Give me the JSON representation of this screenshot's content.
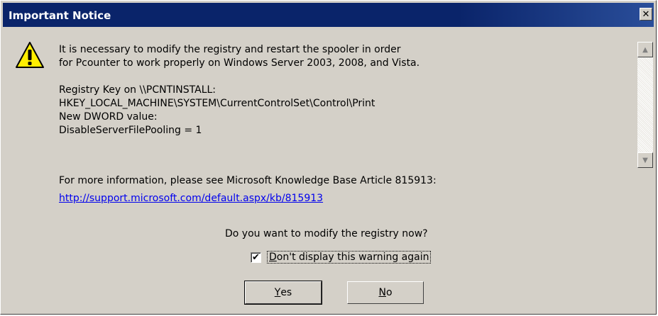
{
  "window": {
    "title": "Important Notice",
    "close_glyph": "✕",
    "icon": "warning-icon"
  },
  "message": {
    "lines": [
      "It is necessary to modify the registry and restart the spooler in order",
      "for Pcounter to work properly on Windows Server 2003, 2008, and Vista.",
      "",
      "Registry Key on \\\\PCNTINSTALL:",
      "HKEY_LOCAL_MACHINE\\SYSTEM\\CurrentControlSet\\Control\\Print",
      "New DWORD value:",
      "DisableServerFilePooling = 1"
    ]
  },
  "info": {
    "text": "For more information, please see Microsoft Knowledge Base Article 815913:",
    "link": "http://support.microsoft.com/default.aspx/kb/815913"
  },
  "question": "Do you want to modify the registry now?",
  "checkbox": {
    "checked": true,
    "mark": "✔",
    "label_prefix": "",
    "label_mnemonic": "D",
    "label_rest": "on't display this warning again"
  },
  "buttons": {
    "yes_mnemonic": "Y",
    "yes_rest": "es",
    "no_mnemonic": "N",
    "no_rest": "o"
  },
  "scrollbar": {
    "up_glyph": "▲",
    "down_glyph": "▼"
  }
}
